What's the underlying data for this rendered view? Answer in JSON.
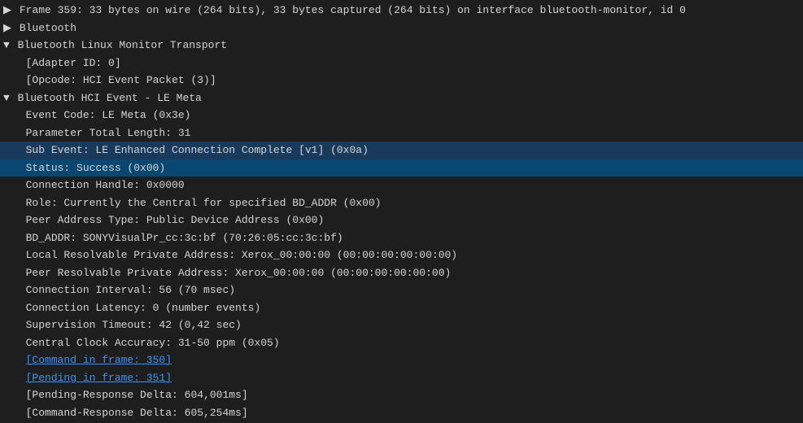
{
  "lines": [
    {
      "id": "frame-summary",
      "indent": 0,
      "expander": "▶",
      "text": "Frame 359: 33 bytes on wire (264 bits), 33 bytes captured (264 bits) on interface bluetooth-monitor, id 0",
      "selected": false,
      "link": false
    },
    {
      "id": "bluetooth",
      "indent": 0,
      "expander": "▶",
      "text": "Bluetooth",
      "selected": false,
      "link": false
    },
    {
      "id": "bt-linux-monitor",
      "indent": 0,
      "expander": "▼",
      "text": "Bluetooth Linux Monitor Transport",
      "selected": false,
      "link": false
    },
    {
      "id": "adapter-id",
      "indent": 1,
      "expander": "",
      "text": "[Adapter ID: 0]",
      "selected": false,
      "link": false
    },
    {
      "id": "opcode",
      "indent": 1,
      "expander": "",
      "text": "[Opcode: HCI Event Packet (3)]",
      "selected": false,
      "link": false
    },
    {
      "id": "bt-hci-event",
      "indent": 0,
      "expander": "▼",
      "text": "Bluetooth HCI Event - LE Meta",
      "selected": false,
      "link": false
    },
    {
      "id": "event-code",
      "indent": 1,
      "expander": "",
      "text": "Event Code: LE Meta (0x3e)",
      "selected": false,
      "link": false
    },
    {
      "id": "param-total-length",
      "indent": 1,
      "expander": "",
      "text": "Parameter Total Length: 31",
      "selected": false,
      "link": false
    },
    {
      "id": "sub-event",
      "indent": 1,
      "expander": "",
      "text": "Sub Event: LE Enhanced Connection Complete [v1] (0x0a)",
      "selected": false,
      "highlighted": true,
      "link": false
    },
    {
      "id": "status",
      "indent": 1,
      "expander": "",
      "text": "Status: Success (0x00)",
      "selected": true,
      "link": false
    },
    {
      "id": "connection-handle",
      "indent": 1,
      "expander": "",
      "text": "Connection Handle: 0x0000",
      "selected": false,
      "link": false
    },
    {
      "id": "role",
      "indent": 1,
      "expander": "",
      "text": "Role: Currently the Central for specified BD_ADDR (0x00)",
      "selected": false,
      "link": false
    },
    {
      "id": "peer-address-type",
      "indent": 1,
      "expander": "",
      "text": "Peer Address Type: Public Device Address (0x00)",
      "selected": false,
      "link": false
    },
    {
      "id": "bd-addr",
      "indent": 1,
      "expander": "",
      "text": "BD_ADDR: SONYVisualPr_cc:3c:bf (70:26:05:cc:3c:bf)",
      "selected": false,
      "link": false
    },
    {
      "id": "local-resolvable",
      "indent": 1,
      "expander": "",
      "text": "Local Resolvable Private Address: Xerox_00:00:00 (00:00:00:00:00:00)",
      "selected": false,
      "link": false
    },
    {
      "id": "peer-resolvable",
      "indent": 1,
      "expander": "",
      "text": "Peer Resolvable Private Address: Xerox_00:00:00 (00:00:00:00:00:00)",
      "selected": false,
      "link": false
    },
    {
      "id": "connection-interval",
      "indent": 1,
      "expander": "",
      "text": "Connection Interval: 56 (70 msec)",
      "selected": false,
      "link": false
    },
    {
      "id": "connection-latency",
      "indent": 1,
      "expander": "",
      "text": "Connection Latency: 0 (number events)",
      "selected": false,
      "link": false
    },
    {
      "id": "supervision-timeout",
      "indent": 1,
      "expander": "",
      "text": "Supervision Timeout: 42 (0,42 sec)",
      "selected": false,
      "link": false
    },
    {
      "id": "central-clock",
      "indent": 1,
      "expander": "",
      "text": "Central Clock Accuracy: 31-50 ppm (0x05)",
      "selected": false,
      "link": false
    },
    {
      "id": "command-in-frame",
      "indent": 1,
      "expander": "",
      "text": "[Command in frame: 350]",
      "selected": false,
      "link": true
    },
    {
      "id": "pending-in-frame",
      "indent": 1,
      "expander": "",
      "text": "[Pending in frame: 351]",
      "selected": false,
      "link": true
    },
    {
      "id": "pending-response-delta",
      "indent": 1,
      "expander": "",
      "text": "[Pending-Response Delta: 604,001ms]",
      "selected": false,
      "link": false
    },
    {
      "id": "command-response-delta",
      "indent": 1,
      "expander": "",
      "text": "[Command-Response Delta: 605,254ms]",
      "selected": false,
      "link": false
    }
  ]
}
